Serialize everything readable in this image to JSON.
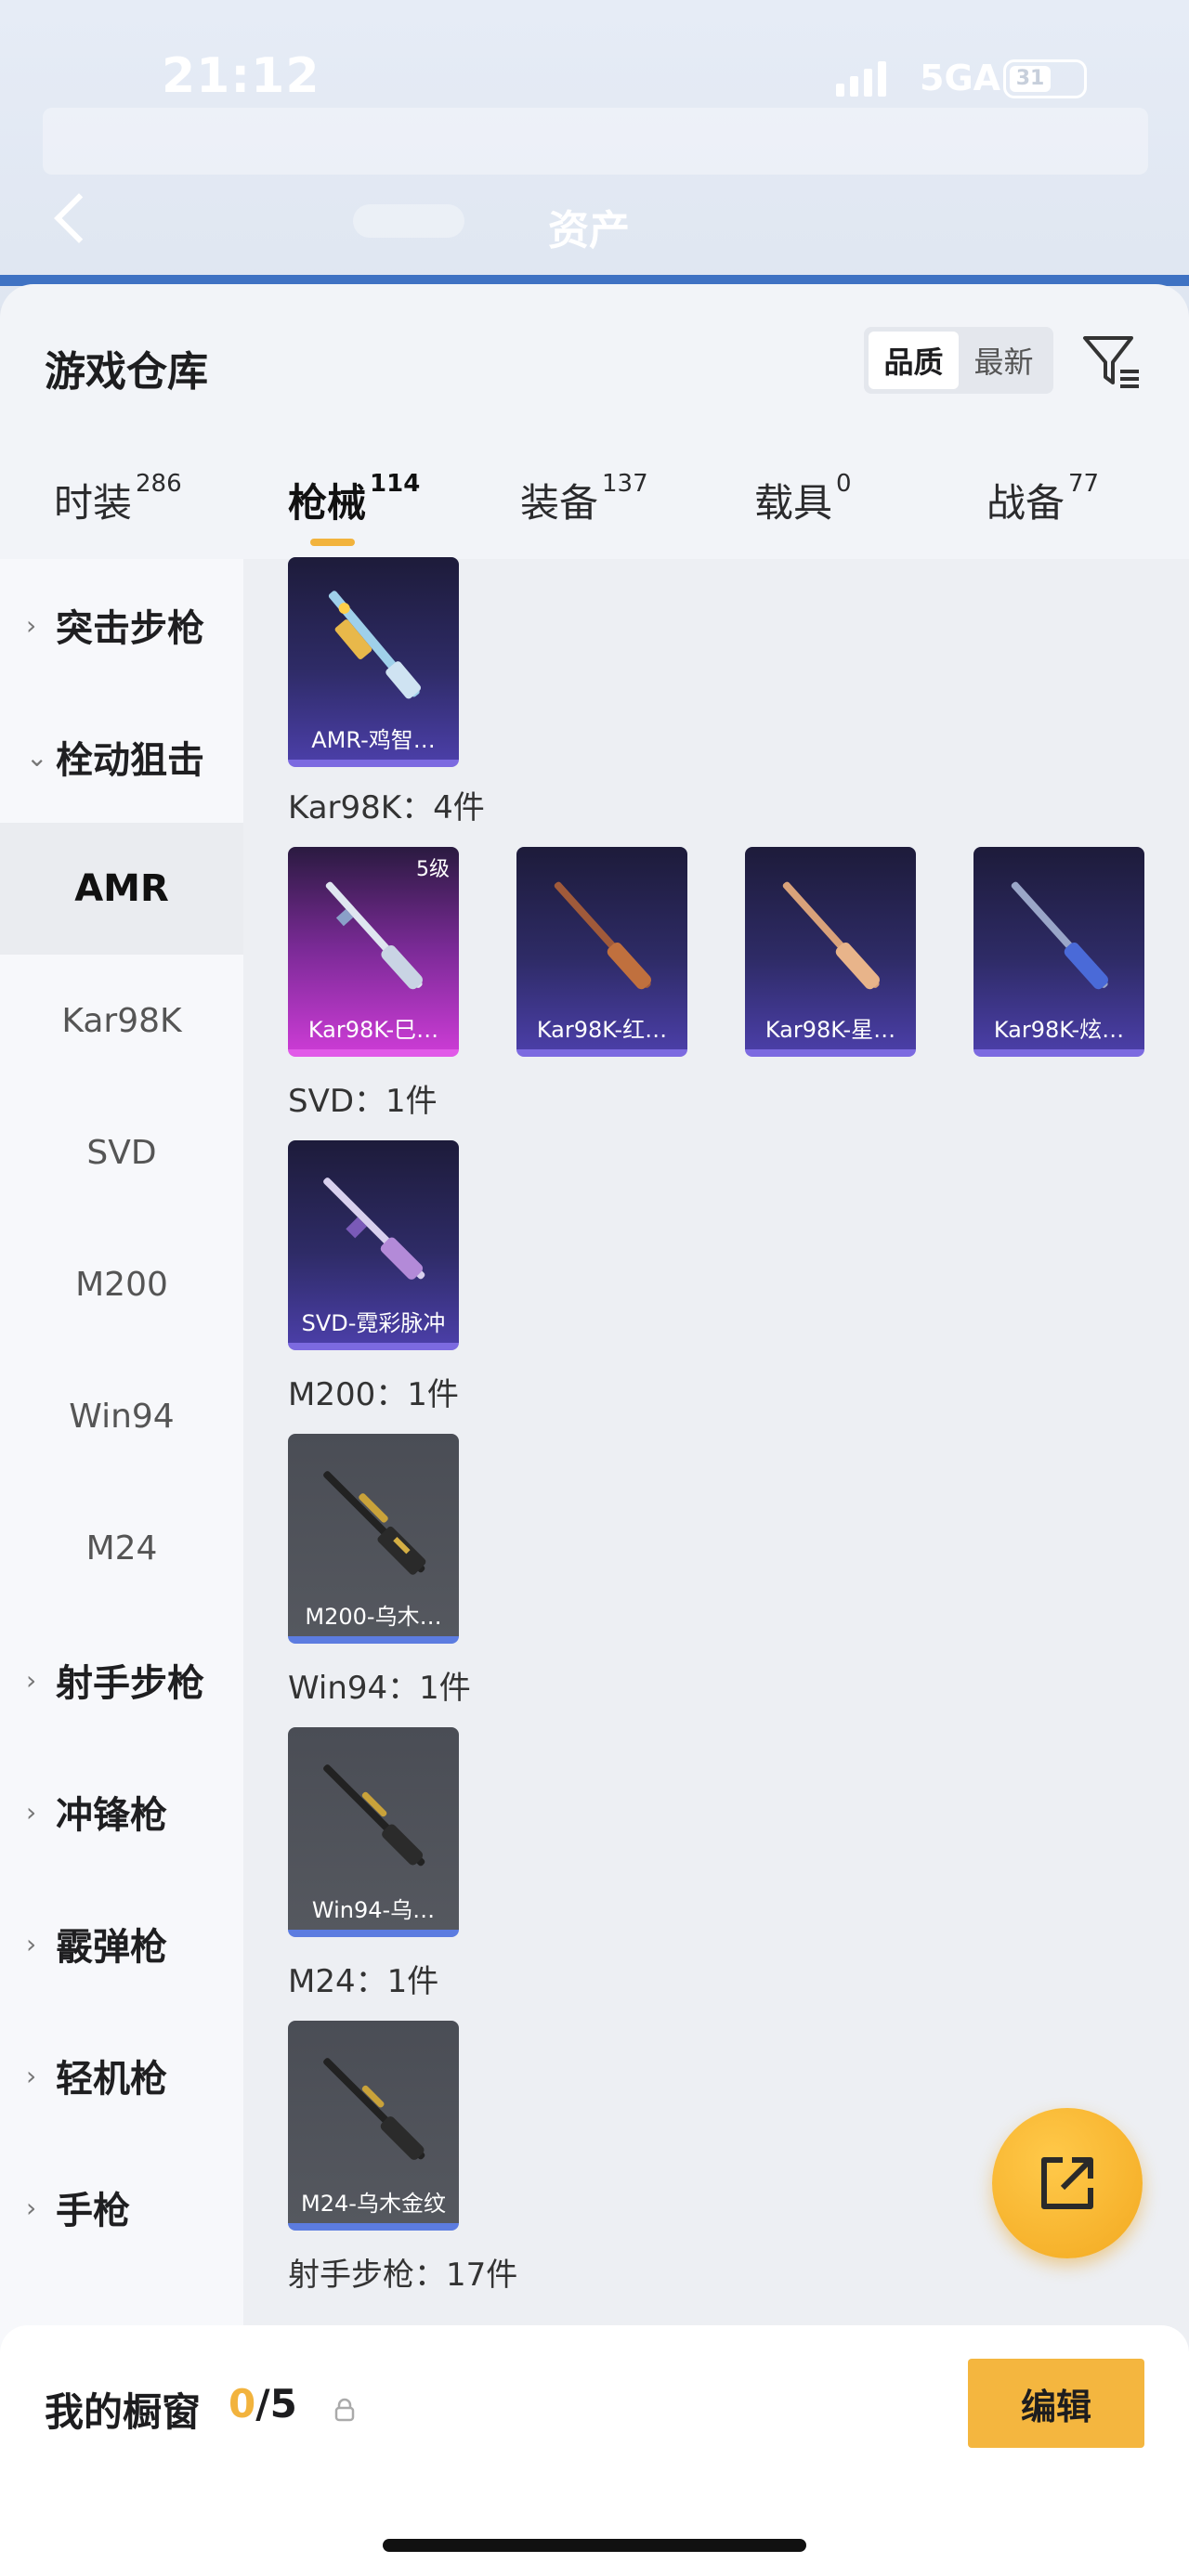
{
  "status_bar": {
    "time": "21:12",
    "network": "5GA",
    "battery": "31"
  },
  "header": {
    "title": "资产"
  },
  "warehouse": {
    "title": "游戏仓库",
    "sort": {
      "quality": "品质",
      "newest": "最新"
    },
    "filter_icon": "filter-icon"
  },
  "tabs": [
    {
      "label": "时装",
      "count": "286"
    },
    {
      "label": "枪械",
      "count": "114"
    },
    {
      "label": "装备",
      "count": "137"
    },
    {
      "label": "载具",
      "count": "0"
    },
    {
      "label": "战备",
      "count": "77"
    }
  ],
  "sidebar": {
    "items": [
      {
        "label": "突击步枪",
        "type": "group"
      },
      {
        "label": "栓动狙击",
        "type": "group-open"
      },
      {
        "label": "AMR",
        "type": "sub-active"
      },
      {
        "label": "Kar98K",
        "type": "sub"
      },
      {
        "label": "SVD",
        "type": "sub"
      },
      {
        "label": "M200",
        "type": "sub"
      },
      {
        "label": "Win94",
        "type": "sub"
      },
      {
        "label": "M24",
        "type": "sub"
      },
      {
        "label": "射手步枪",
        "type": "group"
      },
      {
        "label": "冲锋枪",
        "type": "group"
      },
      {
        "label": "霰弹枪",
        "type": "group"
      },
      {
        "label": "轻机枪",
        "type": "group"
      },
      {
        "label": "手枪",
        "type": "group"
      }
    ]
  },
  "sections": {
    "amr": {
      "cards": [
        {
          "label": "AMR-鸡智…",
          "rarity": "blue"
        }
      ]
    },
    "kar98k": {
      "heading": "Kar98K：4件",
      "cards": [
        {
          "label": "Kar98K-巳…",
          "rarity": "pink",
          "level": "5级"
        },
        {
          "label": "Kar98K-红…",
          "rarity": "blue"
        },
        {
          "label": "Kar98K-星…",
          "rarity": "blue"
        },
        {
          "label": "Kar98K-炫…",
          "rarity": "blue"
        }
      ]
    },
    "svd": {
      "heading": "SVD：1件",
      "cards": [
        {
          "label": "SVD-霓彩脉冲",
          "rarity": "blue"
        }
      ]
    },
    "m200": {
      "heading": "M200：1件",
      "cards": [
        {
          "label": "M200-乌木…",
          "rarity": "gray"
        }
      ]
    },
    "win94": {
      "heading": "Win94：1件",
      "cards": [
        {
          "label": "Win94-乌…",
          "rarity": "gray"
        }
      ]
    },
    "m24": {
      "heading": "M24：1件",
      "cards": [
        {
          "label": "M24-乌木金纹",
          "rarity": "gray"
        }
      ]
    },
    "marksman": {
      "heading": "射手步枪：17件"
    }
  },
  "bottom": {
    "shelf_title": "我的橱窗",
    "shelf_current": "0",
    "shelf_total": "/5",
    "edit_label": "编辑"
  },
  "colors": {
    "accent": "#f4b63f",
    "blue_rarity": "#7c6ae0",
    "pink_rarity": "#e15ae8"
  }
}
